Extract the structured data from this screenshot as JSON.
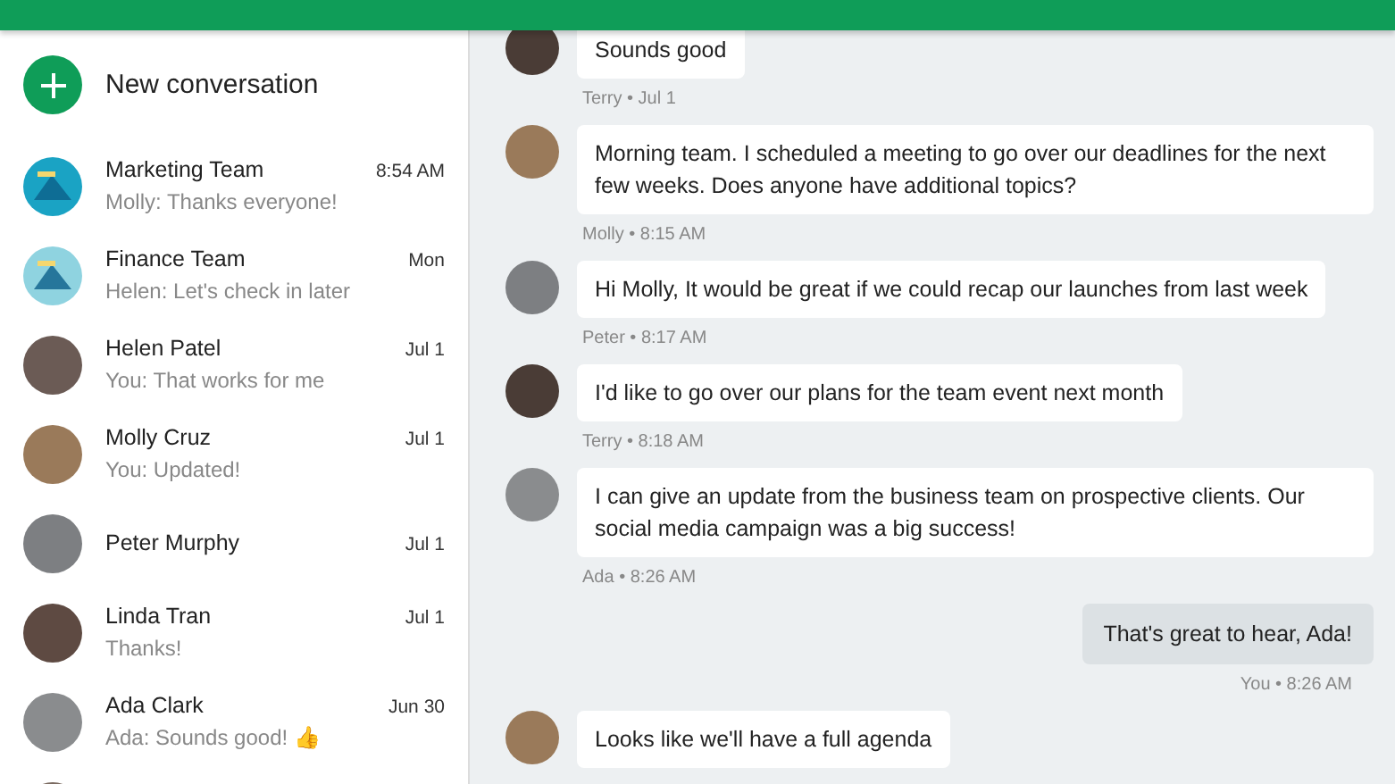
{
  "sidebar": {
    "new_conversation": {
      "label": "New conversation"
    },
    "conversations": [
      {
        "name": "Marketing Team",
        "preview": "Molly: Thanks everyone!",
        "time": "8:54 AM",
        "kind": "group",
        "color": "#1aa3c4"
      },
      {
        "name": "Finance Team",
        "preview": "Helen: Let's check in later",
        "time": "Mon",
        "kind": "group",
        "color": "#8fd3e0"
      },
      {
        "name": "Helen Patel",
        "preview": "You: That works for me",
        "time": "Jul 1",
        "kind": "person",
        "color": "#6b5b55"
      },
      {
        "name": "Molly Cruz",
        "preview": "You: Updated!",
        "time": "Jul 1",
        "kind": "person",
        "color": "#9a7a5a"
      },
      {
        "name": "Peter Murphy",
        "time": "Jul 1",
        "kind": "person",
        "color": "#7d7f82"
      },
      {
        "name": "Linda Tran",
        "preview": "Thanks!",
        "time": "Jul 1",
        "kind": "person",
        "color": "#5e4a42"
      },
      {
        "name": "Ada Clark",
        "preview": "Ada: Sounds good! 👍",
        "time": "Jun 30",
        "kind": "person",
        "color": "#8a8c8e"
      },
      {
        "kind": "partial",
        "color": "#7a6a60"
      }
    ]
  },
  "chat": {
    "messages": [
      {
        "kind": "received",
        "text": "Sounds good",
        "meta": "Terry • Jul 1",
        "color": "#4a3c36"
      },
      {
        "kind": "received",
        "text": "Morning team. I scheduled a meeting to go over our deadlines for the next few weeks. Does anyone have additional topics?",
        "meta": "Molly • 8:15 AM",
        "color": "#9a7a5a"
      },
      {
        "kind": "received",
        "text": "Hi Molly, It would be great if we could recap our launches from last week",
        "meta": "Peter • 8:17 AM",
        "color": "#7d7f82"
      },
      {
        "kind": "received",
        "text": "I'd like to go over our plans for the team event next month",
        "meta": "Terry • 8:18 AM",
        "color": "#4a3c36"
      },
      {
        "kind": "received",
        "text": "I can give an update from the business team on prospective clients. Our social media campaign was a big success!",
        "meta": "Ada • 8:26 AM",
        "color": "#8a8c8e"
      },
      {
        "kind": "sent",
        "text": "That's great to hear, Ada!",
        "meta": "You • 8:26 AM"
      },
      {
        "kind": "received",
        "text": "Looks like we'll have a full agenda",
        "color": "#9a7a5a"
      }
    ]
  }
}
